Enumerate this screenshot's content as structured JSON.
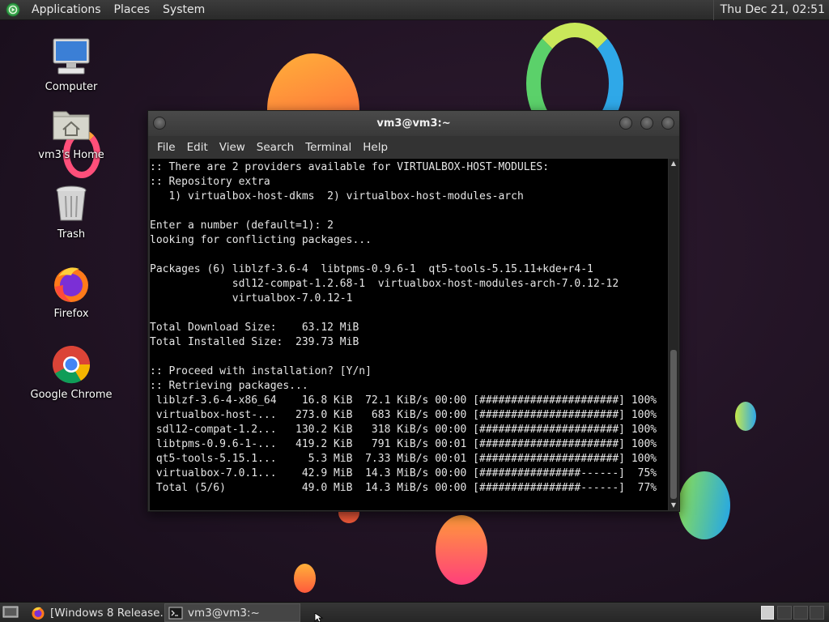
{
  "top_panel": {
    "menus": [
      "Applications",
      "Places",
      "System"
    ],
    "clock": "Thu Dec 21, 02:51"
  },
  "desktop": {
    "icons": [
      {
        "label": "Computer",
        "icon": "computer-icon"
      },
      {
        "label": "vm3's Home",
        "icon": "home-folder-icon"
      },
      {
        "label": "Trash",
        "icon": "trash-icon"
      },
      {
        "label": "Firefox",
        "icon": "firefox-icon"
      },
      {
        "label": "Google Chrome",
        "icon": "chrome-icon"
      }
    ]
  },
  "terminal": {
    "title": "vm3@vm3:~",
    "menu": [
      "File",
      "Edit",
      "View",
      "Search",
      "Terminal",
      "Help"
    ],
    "lines": [
      ":: There are 2 providers available for VIRTUALBOX-HOST-MODULES:",
      ":: Repository extra",
      "   1) virtualbox-host-dkms  2) virtualbox-host-modules-arch",
      "",
      "Enter a number (default=1): 2",
      "looking for conflicting packages...",
      "",
      "Packages (6) liblzf-3.6-4  libtpms-0.9.6-1  qt5-tools-5.15.11+kde+r4-1",
      "             sdl12-compat-1.2.68-1  virtualbox-host-modules-arch-7.0.12-12",
      "             virtualbox-7.0.12-1",
      "",
      "Total Download Size:    63.12 MiB",
      "Total Installed Size:  239.73 MiB",
      "",
      ":: Proceed with installation? [Y/n]",
      ":: Retrieving packages...",
      " liblzf-3.6-4-x86_64    16.8 KiB  72.1 KiB/s 00:00 [######################] 100%",
      " virtualbox-host-...   273.0 KiB   683 KiB/s 00:00 [######################] 100%",
      " sdl12-compat-1.2...   130.2 KiB   318 KiB/s 00:00 [######################] 100%",
      " libtpms-0.9.6-1-...   419.2 KiB   791 KiB/s 00:01 [######################] 100%",
      " qt5-tools-5.15.1...     5.3 MiB  7.33 MiB/s 00:01 [######################] 100%",
      " virtualbox-7.0.1...    42.9 MiB  14.3 MiB/s 00:00 [################------]  75%",
      " Total (5/6)            49.0 MiB  14.3 MiB/s 00:00 [################------]  77%"
    ],
    "scroll_position": 0.55
  },
  "taskbar": {
    "tasks": [
      {
        "label": "[Windows 8 Release...",
        "icon": "firefox-icon",
        "active": false
      },
      {
        "label": "vm3@vm3:~",
        "icon": "terminal-icon",
        "active": true
      }
    ]
  },
  "colors": {
    "desktop_bg": "#221426",
    "panel_bg": "#2e2e2e",
    "terminal_bg": "#000000",
    "terminal_fg": "#e5e5e5"
  }
}
